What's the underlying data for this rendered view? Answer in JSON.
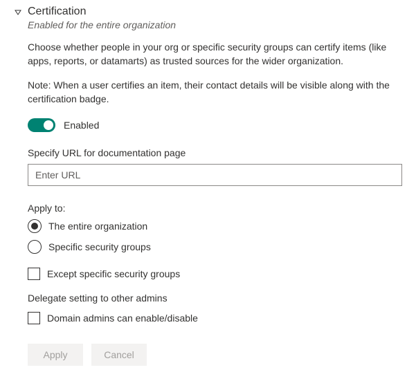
{
  "header": {
    "title": "Certification",
    "subtitle": "Enabled for the entire organization"
  },
  "description": "Choose whether people in your org or specific security groups can certify items (like apps, reports, or datamarts) as trusted sources for the wider organization.",
  "note": "Note: When a user certifies an item, their contact details will be visible along with the certification badge.",
  "toggle": {
    "state_label": "Enabled"
  },
  "url_field": {
    "label": "Specify URL for documentation page",
    "placeholder": "Enter URL",
    "value": ""
  },
  "apply_to": {
    "label": "Apply to:",
    "options": {
      "entire_org": "The entire organization",
      "specific_groups": "Specific security groups"
    },
    "except_label": "Except specific security groups"
  },
  "delegate": {
    "label": "Delegate setting to other admins",
    "domain_admins_label": "Domain admins can enable/disable"
  },
  "buttons": {
    "apply": "Apply",
    "cancel": "Cancel"
  }
}
